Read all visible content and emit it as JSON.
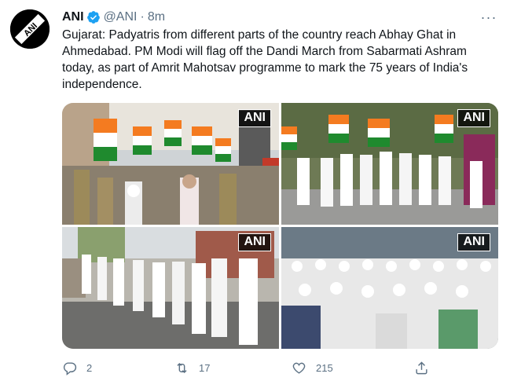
{
  "tweet": {
    "author_name": "ANI",
    "author_handle": "@ANI",
    "separator": "·",
    "time": "8m",
    "text": "Gujarat: Padyatris from different parts of the country reach Abhay Ghat in Ahmedabad. PM Modi will flag off the Dandi March from Sabarmati Ashram today, as part of Amrit Mahotsav programme to mark the 75 years of India's independence.",
    "avatar_label": "ANI",
    "more_label": "···",
    "photos": [
      {
        "watermark": "ANI"
      },
      {
        "watermark": "ANI"
      },
      {
        "watermark": "ANI"
      },
      {
        "watermark": "ANI"
      }
    ],
    "actions": {
      "replies": "2",
      "retweets": "17",
      "likes": "215"
    }
  },
  "colors": {
    "text": "#0f1419",
    "muted": "#5b7083",
    "verified": "#1da1f2"
  }
}
